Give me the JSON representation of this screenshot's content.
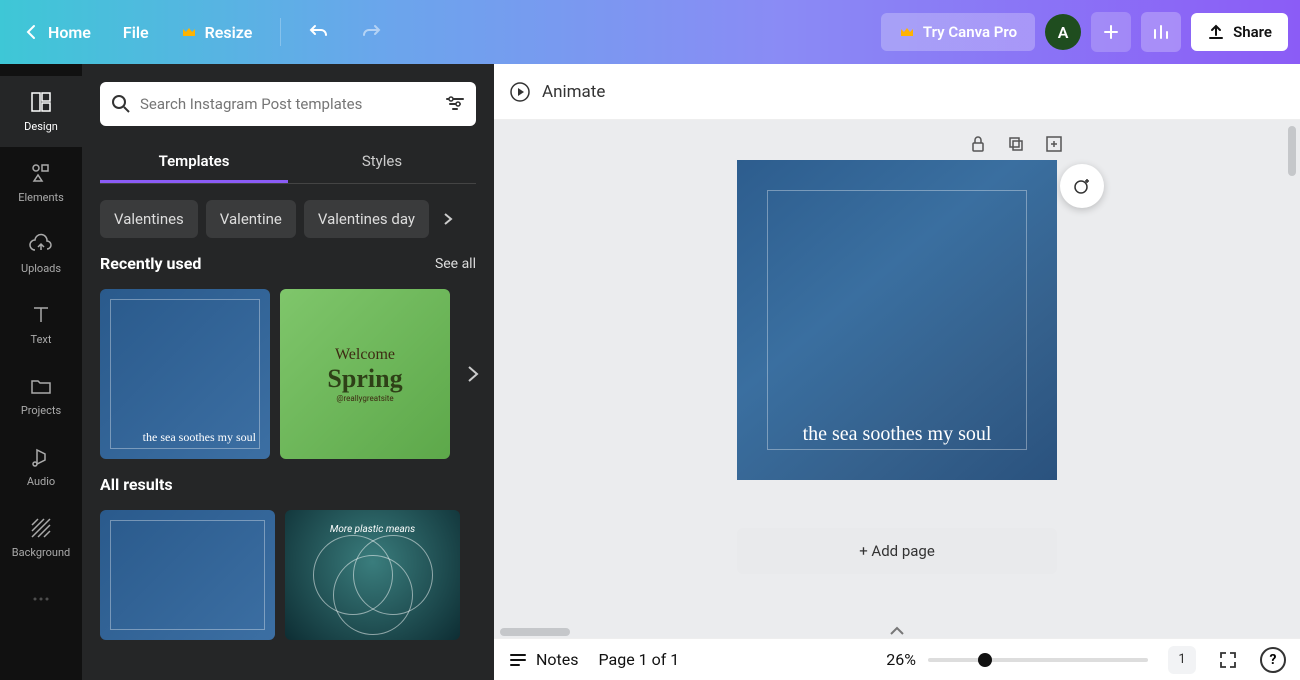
{
  "topbar": {
    "home": "Home",
    "file": "File",
    "resize": "Resize",
    "try_pro": "Try Canva Pro",
    "avatar_initial": "A",
    "share": "Share"
  },
  "rail": {
    "items": [
      {
        "label": "Design"
      },
      {
        "label": "Elements"
      },
      {
        "label": "Uploads"
      },
      {
        "label": "Text"
      },
      {
        "label": "Projects"
      },
      {
        "label": "Audio"
      },
      {
        "label": "Background"
      }
    ]
  },
  "panel": {
    "search_placeholder": "Search Instagram Post templates",
    "tabs": {
      "templates": "Templates",
      "styles": "Styles"
    },
    "chips": [
      "Valentines",
      "Valentine",
      "Valentines day"
    ],
    "recent": {
      "title": "Recently used",
      "see_all": "See all",
      "thumbs": {
        "sea_caption": "the sea soothes my soul",
        "spring_welcome": "Welcome",
        "spring_word": "Spring",
        "spring_handle": "@reallygreatsite"
      }
    },
    "all": {
      "title": "All results",
      "plastic_text": "More plastic means"
    }
  },
  "toolbar": {
    "animate": "Animate"
  },
  "canvas": {
    "text": "the sea soothes my soul",
    "add_page": "+ Add page"
  },
  "bottom": {
    "notes": "Notes",
    "page_label": "Page 1 of 1",
    "zoom": "26%",
    "page_indicator": "1"
  }
}
